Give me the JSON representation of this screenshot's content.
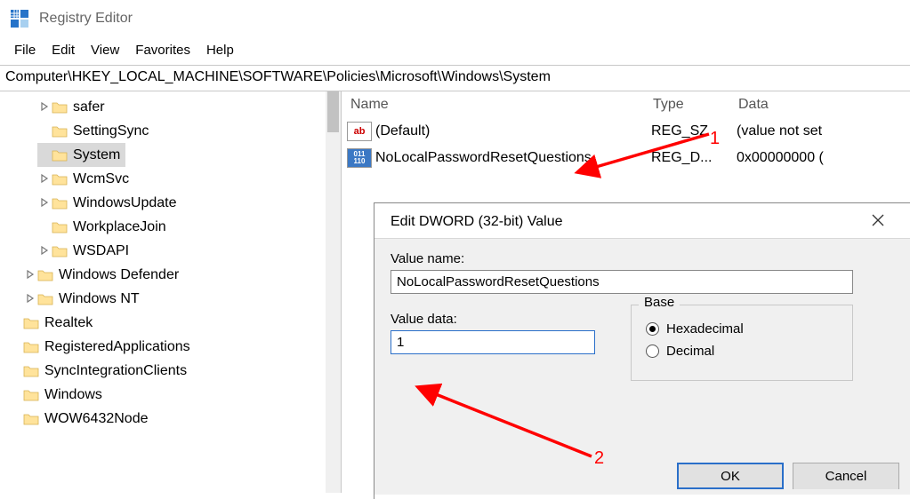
{
  "window": {
    "title": "Registry Editor"
  },
  "menu": {
    "file": "File",
    "edit": "Edit",
    "view": "View",
    "favorites": "Favorites",
    "help": "Help"
  },
  "address": "Computer\\HKEY_LOCAL_MACHINE\\SOFTWARE\\Policies\\Microsoft\\Windows\\System",
  "tree": {
    "items": [
      {
        "label": "safer",
        "chev": true,
        "depth": 1
      },
      {
        "label": "SettingSync",
        "chev": false,
        "depth": 1
      },
      {
        "label": "System",
        "chev": false,
        "depth": 1,
        "selected": true
      },
      {
        "label": "WcmSvc",
        "chev": true,
        "depth": 1
      },
      {
        "label": "WindowsUpdate",
        "chev": true,
        "depth": 1
      },
      {
        "label": "WorkplaceJoin",
        "chev": false,
        "depth": 1
      },
      {
        "label": "WSDAPI",
        "chev": true,
        "depth": 1
      },
      {
        "label": "Windows Defender",
        "chev": true,
        "depth": 2
      },
      {
        "label": "Windows NT",
        "chev": true,
        "depth": 2
      },
      {
        "label": "Realtek",
        "chev": false,
        "depth": 3
      },
      {
        "label": "RegisteredApplications",
        "chev": false,
        "depth": 3
      },
      {
        "label": "SyncIntegrationClients",
        "chev": false,
        "depth": 3
      },
      {
        "label": "Windows",
        "chev": false,
        "depth": 3
      },
      {
        "label": "WOW6432Node",
        "chev": false,
        "depth": 3
      }
    ]
  },
  "list": {
    "cols": {
      "name": "Name",
      "type": "Type",
      "data": "Data"
    },
    "rows": [
      {
        "icon": "str",
        "iconText": "ab",
        "name": "(Default)",
        "type": "REG_SZ",
        "data": "(value not set"
      },
      {
        "icon": "bin",
        "iconText": "011\n110",
        "name": "NoLocalPasswordResetQuestions",
        "type": "REG_D...",
        "data": "0x00000000 ("
      }
    ]
  },
  "dialog": {
    "title": "Edit DWORD (32-bit) Value",
    "valuename_label": "Value name:",
    "valuename": "NoLocalPasswordResetQuestions",
    "valuedata_label": "Value data:",
    "valuedata": "1",
    "base_label": "Base",
    "hex": "Hexadecimal",
    "dec": "Decimal",
    "ok": "OK",
    "cancel": "Cancel"
  },
  "annotations": {
    "numbers": [
      "1",
      "2"
    ]
  }
}
